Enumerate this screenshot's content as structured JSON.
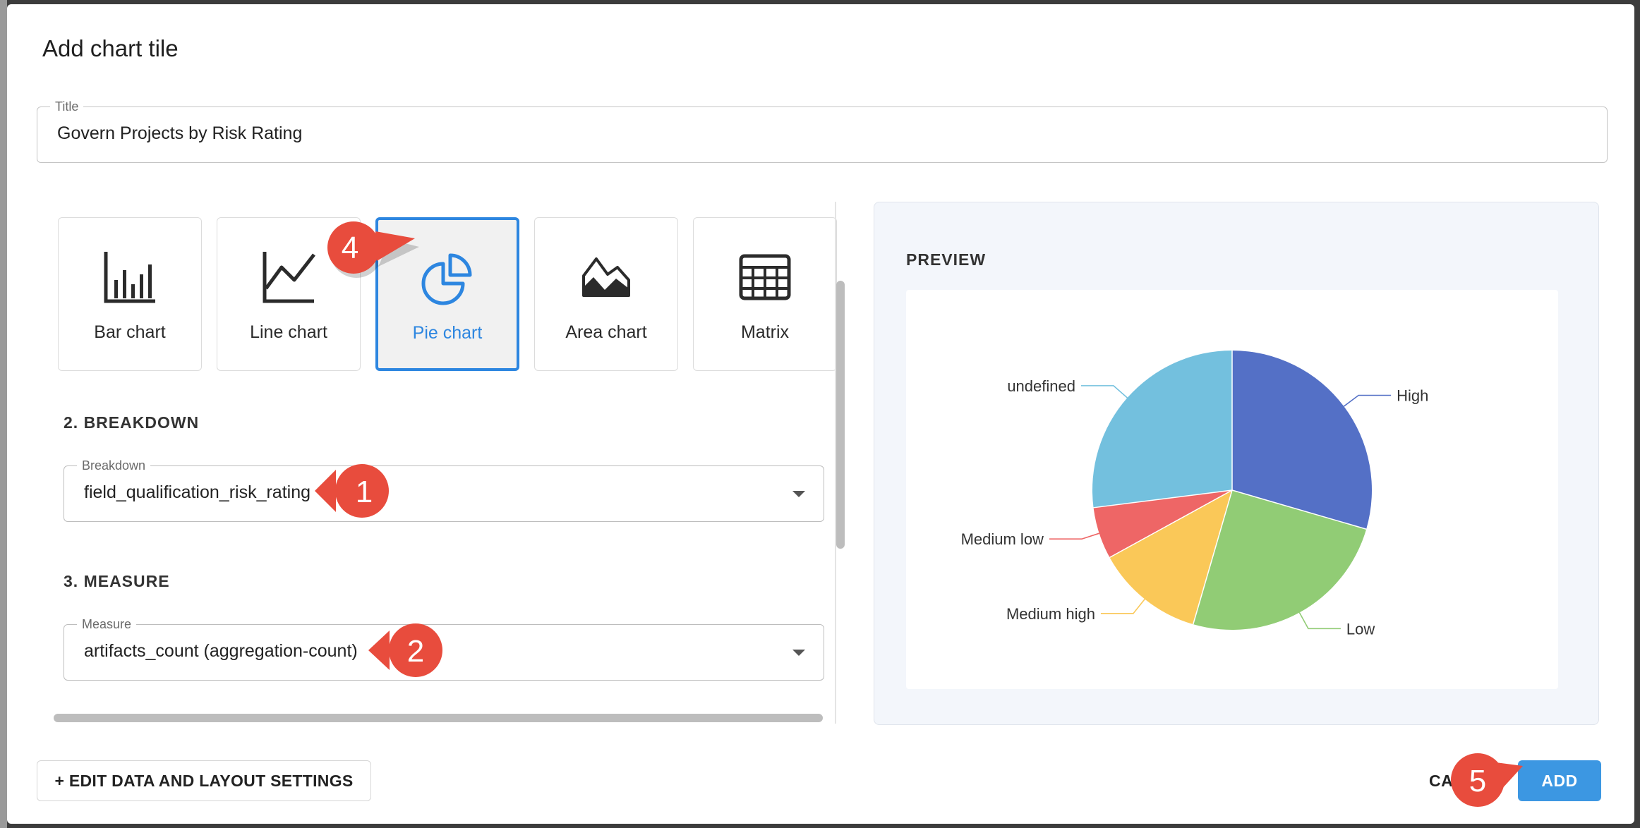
{
  "dialog": {
    "title": "Add chart tile"
  },
  "title_field": {
    "legend": "Title",
    "value": "Govern Projects by Risk Rating"
  },
  "chart_types": [
    {
      "label": "Bar chart",
      "icon": "bar-chart-icon",
      "selected": false
    },
    {
      "label": "Line chart",
      "icon": "line-chart-icon",
      "selected": false
    },
    {
      "label": "Pie chart",
      "icon": "pie-chart-icon",
      "selected": true
    },
    {
      "label": "Area chart",
      "icon": "area-chart-icon",
      "selected": false
    },
    {
      "label": "Matrix",
      "icon": "matrix-icon",
      "selected": false
    }
  ],
  "breakdown": {
    "heading": "2. BREAKDOWN",
    "legend": "Breakdown",
    "value": "field_qualification_risk_rating"
  },
  "measure": {
    "heading": "3. MEASURE",
    "legend": "Measure",
    "value": "artifacts_count (aggregation-count)"
  },
  "preview": {
    "heading": "PREVIEW"
  },
  "chart_data": {
    "type": "pie",
    "categories": [
      "High",
      "Low",
      "Medium high",
      "Medium low",
      "undefined"
    ],
    "values": [
      29.5,
      25,
      12.5,
      6,
      27
    ],
    "colors": [
      "#5470c6",
      "#91cc75",
      "#fac858",
      "#ee6666",
      "#73c0de"
    ],
    "legend": "none",
    "labels": "outside with leader lines"
  },
  "footer": {
    "edit_label": "+ EDIT DATA AND LAYOUT SETTINGS",
    "cancel_label": "CA",
    "add_label": "ADD"
  },
  "callouts": [
    {
      "number": "1",
      "color": "#e84c3d"
    },
    {
      "number": "2",
      "color": "#e84c3d"
    },
    {
      "number": "4",
      "color": "#e84c3d"
    },
    {
      "number": "5",
      "color": "#e84c3d"
    }
  ]
}
